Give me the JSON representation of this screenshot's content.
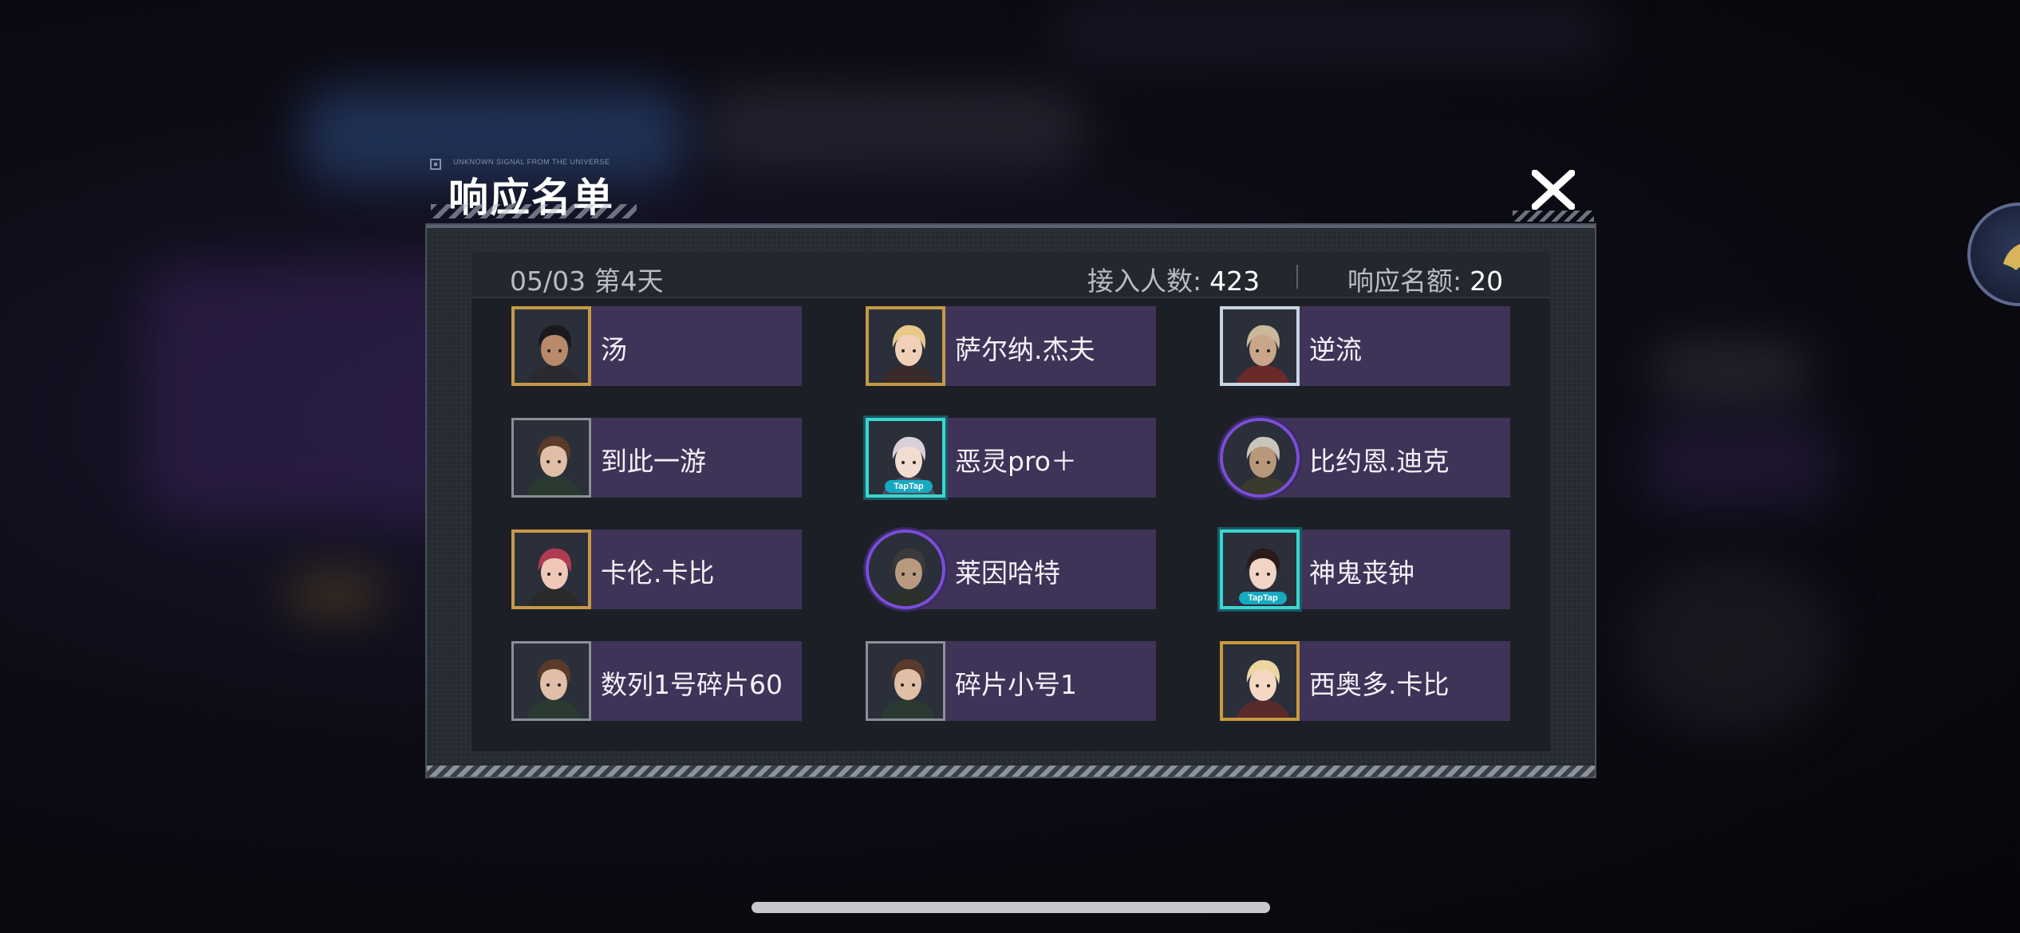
{
  "dialog": {
    "header_subtitle": "UNKNOWN SIGNAL FROM THE UNIVERSE",
    "title": "响应名单",
    "close_label": "X"
  },
  "info": {
    "date": "05/03 第4天",
    "join_label": "接入人数:",
    "join_value": "423",
    "quota_label": "响应名额:",
    "quota_value": "20"
  },
  "players": [
    {
      "name": "汤",
      "frame": "gold",
      "hair": "#1a1a1e",
      "skin": "#b88a6a",
      "shirt": "#2a2a30"
    },
    {
      "name": "萨尔纳.杰夫",
      "frame": "gold",
      "hair": "#e8c98a",
      "skin": "#f0d0b8",
      "shirt": "#3a2a2a"
    },
    {
      "name": "逆流",
      "frame": "silver",
      "hair": "#c9b89a",
      "skin": "#c9a68a",
      "shirt": "#6a2a2a"
    },
    {
      "name": "到此一游",
      "frame": "plain",
      "hair": "#5a3a2a",
      "skin": "#e0bfa6",
      "shirt": "#2a3a30"
    },
    {
      "name": "恶灵pro＋",
      "frame": "teal",
      "hair": "#d8d0d8",
      "skin": "#f2dcd0",
      "shirt": "#4a4a5a",
      "badge": "TapTap"
    },
    {
      "name": "比约恩.迪克",
      "frame": "purple",
      "hair": "#c8c4bc",
      "skin": "#b8987a",
      "shirt": "#3a3a2e"
    },
    {
      "name": "卡伦.卡比",
      "frame": "gold",
      "hair": "#b03a52",
      "skin": "#f0c8b8",
      "shirt": "#2a2a2a"
    },
    {
      "name": "莱因哈特",
      "frame": "purple",
      "hair": "#3a3a3a",
      "skin": "#b89a80",
      "shirt": "#2a302a"
    },
    {
      "name": "神鬼丧钟",
      "frame": "teal",
      "hair": "#2a1a1a",
      "skin": "#f0d4c4",
      "shirt": "#2a2a3a",
      "badge": "TapTap"
    },
    {
      "name": "数列1号碎片60",
      "frame": "plain",
      "hair": "#5a3a2a",
      "skin": "#e0bfa6",
      "shirt": "#2a3a30"
    },
    {
      "name": "碎片小号1",
      "frame": "plain",
      "hair": "#5a3a2a",
      "skin": "#e0bfa6",
      "shirt": "#2a3a30"
    },
    {
      "name": "西奥多.卡比",
      "frame": "red",
      "hair": "#ecd6a0",
      "skin": "#f4d8c4",
      "shirt": "#5a2a2a"
    }
  ]
}
